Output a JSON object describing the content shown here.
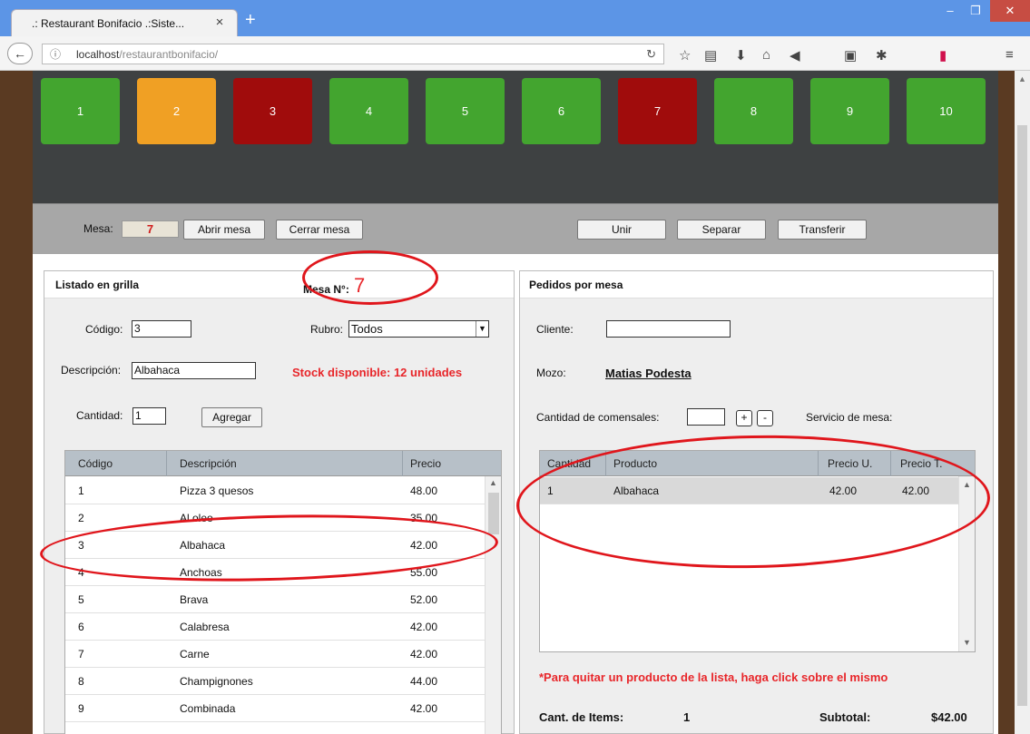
{
  "browser": {
    "tab_title": ".: Restaurant Bonifacio .:Siste...",
    "tab_close": "×",
    "new_tab": "+",
    "window_controls": {
      "minimize": "–",
      "restore": "❐",
      "close": "✕"
    },
    "url_host": "localhost",
    "url_path": "/restaurantbonifacio/",
    "icons": [
      "reload-icon",
      "bookmark-star-icon",
      "reading-list-icon",
      "download-icon",
      "home-icon",
      "send-icon",
      "extension-icon",
      "menu-icon"
    ]
  },
  "tables": [
    {
      "number": "1",
      "status": "free",
      "color": "#43a52f"
    },
    {
      "number": "2",
      "status": "reserved",
      "color": "#f0a024"
    },
    {
      "number": "3",
      "status": "occupied",
      "color": "#a00c0c"
    },
    {
      "number": "4",
      "status": "free",
      "color": "#43a52f"
    },
    {
      "number": "5",
      "status": "free",
      "color": "#43a52f"
    },
    {
      "number": "6",
      "status": "free",
      "color": "#43a52f"
    },
    {
      "number": "7",
      "status": "occupied",
      "color": "#a00c0c"
    },
    {
      "number": "8",
      "status": "free",
      "color": "#43a52f"
    },
    {
      "number": "9",
      "status": "free",
      "color": "#43a52f"
    },
    {
      "number": "10",
      "status": "free",
      "color": "#43a52f"
    }
  ],
  "control": {
    "mesa_label": "Mesa:",
    "mesa_value": "7",
    "abrir": "Abrir mesa",
    "cerrar": "Cerrar mesa",
    "unir": "Unir",
    "separar": "Separar",
    "transferir": "Transferir"
  },
  "left": {
    "title": "Listado en grilla",
    "mesa_label": "Mesa N°:",
    "mesa_value": "7",
    "codigo_label": "Código:",
    "codigo_value": "3",
    "rubro_label": "Rubro:",
    "rubro_value": "Todos",
    "descripcion_label": "Descripción:",
    "descripcion_value": "Albahaca",
    "stock": "Stock disponible: 12 unidades",
    "cantidad_label": "Cantidad:",
    "cantidad_value": "1",
    "agregar": "Agregar",
    "columns": [
      "Código",
      "Descripción",
      "Precio"
    ],
    "rows": [
      [
        "1",
        "Pizza 3 quesos",
        "48.00"
      ],
      [
        "2",
        "Al oleo",
        "35.00"
      ],
      [
        "3",
        "Albahaca",
        "42.00"
      ],
      [
        "4",
        "Anchoas",
        "55.00"
      ],
      [
        "5",
        "Brava",
        "52.00"
      ],
      [
        "6",
        "Calabresa",
        "42.00"
      ],
      [
        "7",
        "Carne",
        "42.00"
      ],
      [
        "8",
        "Champignones",
        "44.00"
      ],
      [
        "9",
        "Combinada",
        "42.00"
      ]
    ]
  },
  "right": {
    "title": "Pedidos por mesa",
    "cliente_label": "Cliente:",
    "cliente_value": "",
    "mozo_label": "Mozo:",
    "mozo_value": "Matias Podesta",
    "comensales_label": "Cantidad de comensales:",
    "plus": "+",
    "minus": "-",
    "servicio_label": "Servicio de mesa:",
    "columns": [
      "Cantidad",
      "Producto",
      "Precio U.",
      "Precio T."
    ],
    "rows": [
      [
        "1",
        "Albahaca",
        "42.00",
        "42.00"
      ]
    ],
    "hint": "*Para quitar un producto de la lista, haga click sobre el mismo",
    "items_label": "Cant. de Items:",
    "items_value": "1",
    "subtotal_label": "Subtotal:",
    "subtotal_value": "$42.00"
  }
}
